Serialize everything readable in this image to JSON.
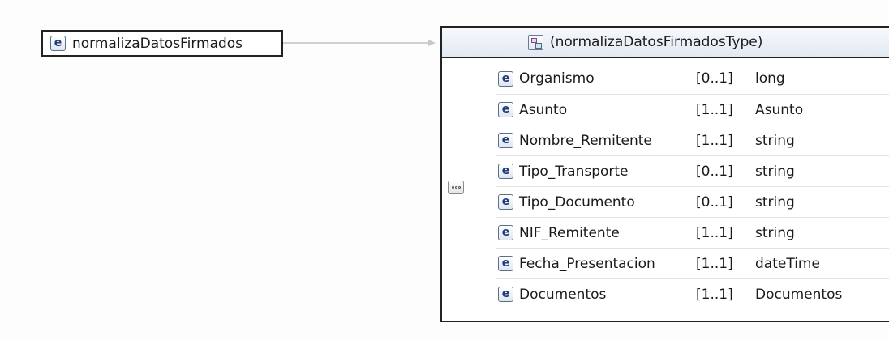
{
  "root_element": {
    "icon": "element-icon",
    "icon_glyph": "e",
    "label": "normalizaDatosFirmados"
  },
  "complex_type": {
    "icon": "complex-type-icon",
    "label": "(normalizaDatosFirmadosType)"
  },
  "sequence": {
    "icon": "sequence-compositor-icon",
    "elements": [
      {
        "name": "Organismo",
        "occurrence": "[0..1]",
        "type": "long"
      },
      {
        "name": "Asunto",
        "occurrence": "[1..1]",
        "type": "Asunto"
      },
      {
        "name": "Nombre_Remitente",
        "occurrence": "[1..1]",
        "type": "string"
      },
      {
        "name": "Tipo_Transporte",
        "occurrence": "[0..1]",
        "type": "string"
      },
      {
        "name": "Tipo_Documento",
        "occurrence": "[0..1]",
        "type": "string"
      },
      {
        "name": "NIF_Remitente",
        "occurrence": "[1..1]",
        "type": "string"
      },
      {
        "name": "Fecha_Presentacion",
        "occurrence": "[1..1]",
        "type": "dateTime"
      },
      {
        "name": "Documentos",
        "occurrence": "[1..1]",
        "type": "Documentos"
      }
    ]
  }
}
